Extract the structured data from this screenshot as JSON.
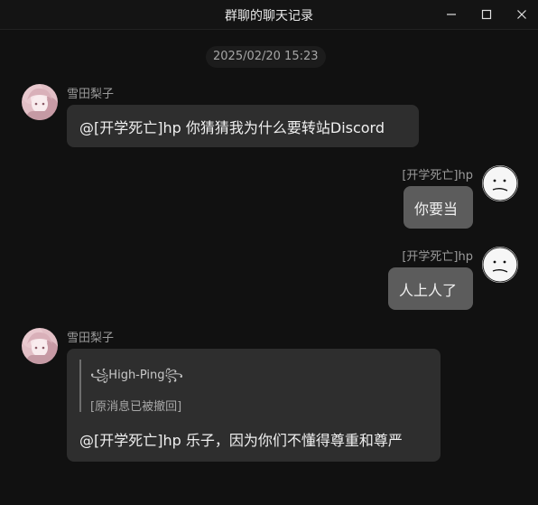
{
  "window": {
    "title": "群聊的聊天记录"
  },
  "timestamp": "2025/02/20 15:23",
  "messages": [
    {
      "sender": "雪田梨子",
      "side": "left",
      "avatar": "anime-girl-avatar",
      "text": "@[开学死亡]hp 你猜猜我为什么要转站Discord"
    },
    {
      "sender": "[开学死亡]hp",
      "side": "right",
      "avatar": "doodle-face-avatar",
      "text": "你要当"
    },
    {
      "sender": "[开学死亡]hp",
      "side": "right",
      "avatar": "doodle-face-avatar",
      "text": "人上人了"
    },
    {
      "sender": "雪田梨子",
      "side": "left",
      "avatar": "anime-girl-avatar",
      "reply": {
        "name": "꧁High-Ping꧂",
        "text": "[原消息已被撤回]"
      },
      "text": "@[开学死亡]hp 乐子，因为你们不懂得尊重和尊严"
    }
  ],
  "colors": {
    "background": "#111111",
    "left_bubble": "#2e2e2e",
    "right_bubble": "#5c5c5c",
    "sender_text": "#9a9a9a"
  },
  "icons": {
    "minimize": "minimize-icon",
    "maximize": "maximize-icon",
    "close": "close-icon"
  }
}
